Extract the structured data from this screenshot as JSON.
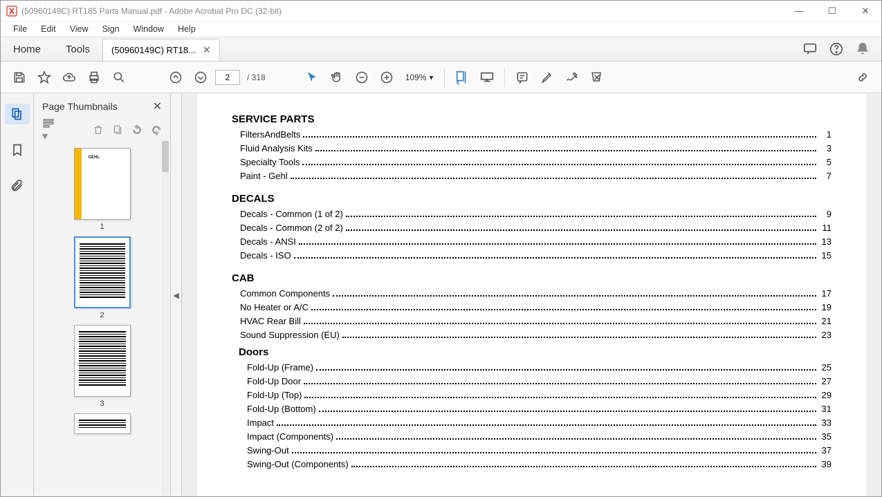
{
  "window": {
    "title": "(50960149C) RT185 Parts Manual.pdf - Adobe Acrobat Pro DC (32-bit)"
  },
  "menu": {
    "file": "File",
    "edit": "Edit",
    "view": "View",
    "sign": "Sign",
    "window": "Window",
    "help": "Help"
  },
  "tabs": {
    "home": "Home",
    "tools": "Tools",
    "doc": "(50960149C) RT18..."
  },
  "toolbar": {
    "current_page": "2",
    "page_total": "/ 318",
    "zoom": "109%"
  },
  "sidebar": {
    "title": "Page Thumbnails",
    "thumbs": [
      {
        "num": "1"
      },
      {
        "num": "2"
      },
      {
        "num": "3"
      }
    ]
  },
  "document": {
    "sections": [
      {
        "heading": "SERVICE PARTS",
        "items": [
          {
            "label": "FiltersAndBelts",
            "page": "1"
          },
          {
            "label": "Fluid Analysis Kits",
            "page": "3"
          },
          {
            "label": "Specialty Tools",
            "page": "5"
          },
          {
            "label": "Paint - Gehl",
            "page": "7"
          }
        ]
      },
      {
        "heading": "DECALS",
        "items": [
          {
            "label": "Decals - Common (1 of 2)",
            "page": "9"
          },
          {
            "label": "Decals - Common (2 of 2)",
            "page": "11"
          },
          {
            "label": "Decals - ANSI",
            "page": "13"
          },
          {
            "label": "Decals - ISO",
            "page": "15"
          }
        ]
      },
      {
        "heading": "CAB",
        "items": [
          {
            "label": "Common Components",
            "page": "17"
          },
          {
            "label": "No Heater or A/C",
            "page": "19"
          },
          {
            "label": "HVAC Rear Bill",
            "page": "21"
          },
          {
            "label": "Sound Suppression (EU)",
            "page": "23"
          }
        ],
        "subsections": [
          {
            "heading": "Doors",
            "items": [
              {
                "label": "Fold-Up (Frame)",
                "page": "25"
              },
              {
                "label": "Fold-Up Door",
                "page": "27"
              },
              {
                "label": "Fold-Up (Top)",
                "page": "29"
              },
              {
                "label": "Fold-Up (Bottom)",
                "page": "31"
              },
              {
                "label": "Impact",
                "page": "33"
              },
              {
                "label": "Impact (Components)",
                "page": "35"
              },
              {
                "label": "Swing-Out",
                "page": "37"
              },
              {
                "label": "Swing-Out (Components)",
                "page": "39"
              }
            ]
          }
        ]
      }
    ]
  }
}
